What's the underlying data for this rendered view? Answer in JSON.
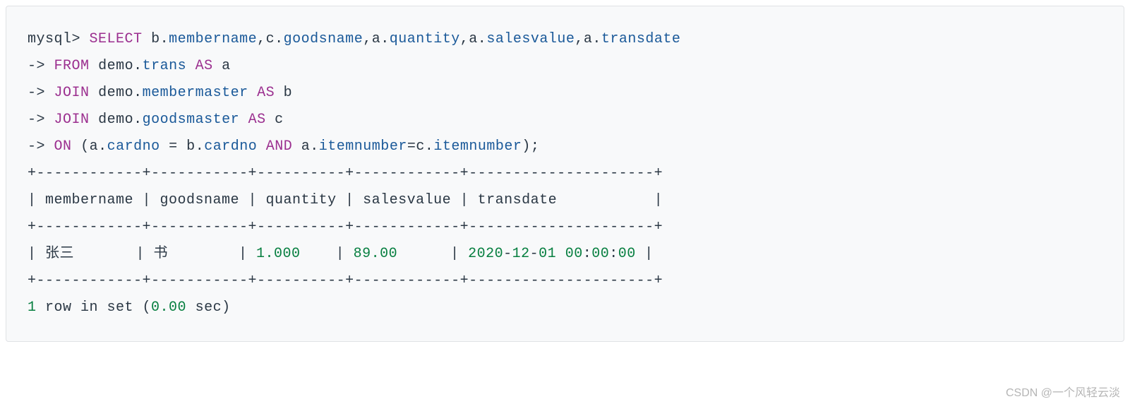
{
  "prompt": "mysql>",
  "sql": {
    "select": "SELECT",
    "from": "FROM",
    "join": "JOIN",
    "on": "ON",
    "as": "AS",
    "and": "AND",
    "arrow": "->",
    "b": "b",
    "c": "c",
    "a": "a",
    "dot": ".",
    "comma": ",",
    "eq": "=",
    "lp": "(",
    "rp": ")",
    "sc": ";",
    "demo": "demo",
    "trans": "trans",
    "membermaster": "membermaster",
    "goodsmaster": "goodsmaster",
    "membername": "membername",
    "goodsname": "goodsname",
    "quantity": "quantity",
    "salesvalue": "salesvalue",
    "transdate": "transdate",
    "cardno": "cardno",
    "itemnumber": "itemnumber"
  },
  "table": {
    "border": "+------------+-----------+----------+------------+---------------------+",
    "header": "| membername | goodsname | quantity | salesvalue | transdate           |",
    "row1_p1": "| 张三       | 书        | ",
    "row1_v1": "1.000",
    "row1_p2": "    | ",
    "row1_v2": "89.00",
    "row1_p3": "      | ",
    "row1_v3": "2020",
    "row1_p4": "-",
    "row1_v4": "12",
    "row1_p5": "-",
    "row1_v5": "01",
    "row1_p6": " ",
    "row1_v6": "00",
    "row1_p7": ":",
    "row1_v7": "00",
    "row1_p8": ":",
    "row1_v8": "00",
    "row1_p9": " |"
  },
  "footer": {
    "p1": "1",
    "p2": " row in set (",
    "p3": "0.00",
    "p4": " sec)"
  },
  "watermark": "CSDN @一个风轻云淡"
}
